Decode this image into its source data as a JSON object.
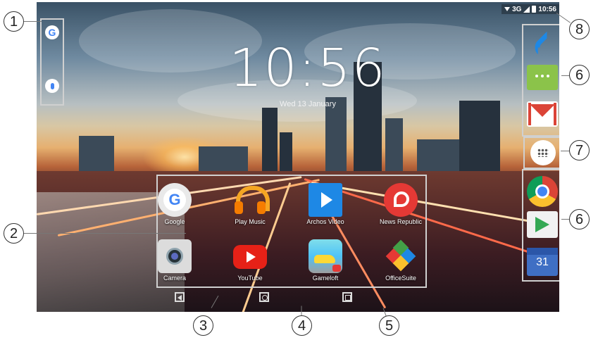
{
  "status_bar": {
    "network": "3G",
    "time": "10:56"
  },
  "home": {
    "clock": "10:56",
    "date": "Wed 13 January"
  },
  "search_bar": {
    "google_icon": "google-icon",
    "mic_icon": "mic-icon"
  },
  "apps": [
    {
      "label": "Google",
      "icon": "google-folder-icon"
    },
    {
      "label": "Play Music",
      "icon": "play-music-icon"
    },
    {
      "label": "Archos Video",
      "icon": "archos-video-icon"
    },
    {
      "label": "News Republic",
      "icon": "news-republic-icon"
    },
    {
      "label": "Camera",
      "icon": "camera-icon"
    },
    {
      "label": "YouTube",
      "icon": "youtube-icon"
    },
    {
      "label": "Gameloft",
      "icon": "gameloft-icon"
    },
    {
      "label": "OfficeSuite",
      "icon": "officesuite-icon"
    }
  ],
  "dock": {
    "top": [
      "phone-icon",
      "messaging-icon",
      "gmail-icon"
    ],
    "drawer": "app-drawer-icon",
    "bottom": [
      "chrome-icon",
      "play-store-icon"
    ],
    "calendar_day": "31"
  },
  "nav": [
    "back-icon",
    "home-icon",
    "recent-apps-icon"
  ],
  "callouts": [
    "1",
    "2",
    "3",
    "4",
    "5",
    "6",
    "7",
    "6",
    "8"
  ],
  "colors": {
    "frame": "#d0d0d0",
    "callout_border": "#333333"
  }
}
